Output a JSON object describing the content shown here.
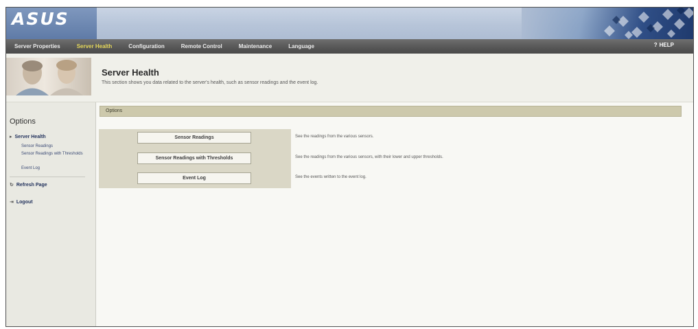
{
  "header": {
    "logo": "ASUS",
    "logo_sub": "",
    "help": "HELP",
    "help_icon": "question-icon"
  },
  "nav": {
    "tabs": [
      {
        "label": "Server Properties"
      },
      {
        "label": "Server Health",
        "active": true
      },
      {
        "label": "Configuration"
      },
      {
        "label": "Remote Control"
      },
      {
        "label": "Maintenance"
      },
      {
        "label": "Language"
      }
    ]
  },
  "title": {
    "heading": "Server Health",
    "description": "This section shows you data related to the server's health, such as sensor readings and the event log."
  },
  "sidebar": {
    "heading": "Options",
    "section": "Server Health",
    "items": [
      {
        "label": "Sensor Readings"
      },
      {
        "label": "Sensor Readings with Thresholds"
      },
      {
        "label": "Event Log"
      }
    ],
    "refresh": "Refresh Page",
    "logout": "Logout"
  },
  "content": {
    "bar_label": "Options",
    "buttons": [
      {
        "label": "Sensor Readings",
        "desc": "See the readings from the various sensors."
      },
      {
        "label": "Sensor Readings with Thresholds",
        "desc": "See the readings from the various sensors, with their lower and upper thresholds."
      },
      {
        "label": "Event Log",
        "desc": "See the events written to the event log."
      }
    ]
  },
  "colors": {
    "nav_active": "#e6d85a",
    "options_bar": "#cdc9ac",
    "panel": "#dad7c6"
  }
}
